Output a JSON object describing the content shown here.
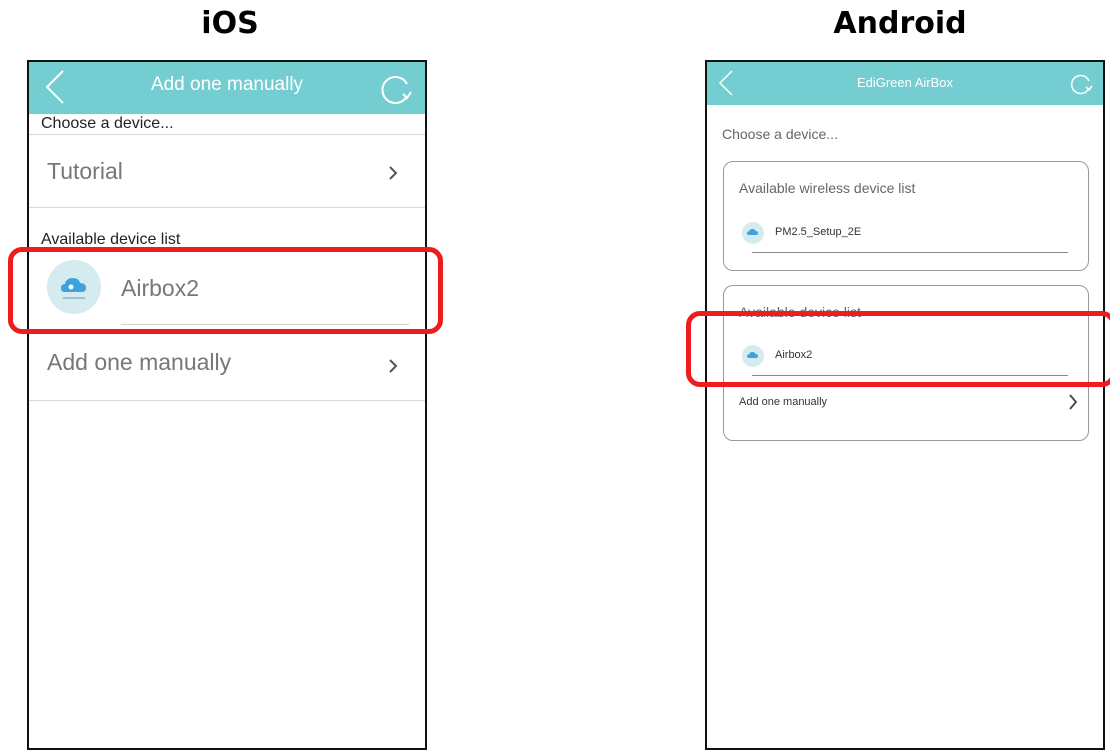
{
  "headings": {
    "ios": "iOS",
    "android": "Android"
  },
  "ios": {
    "title": "Add one manually",
    "choose_label": "Choose a device...",
    "tutorial_label": "Tutorial",
    "available_list_label": "Available device list",
    "device_name": "Airbox2",
    "add_manually_label": "Add one manually"
  },
  "android": {
    "title": "EdiGreen AirBox",
    "choose_label": "Choose a device...",
    "wireless_list_label": "Available wireless device list",
    "wireless_device_name": "PM2.5_Setup_2E",
    "available_list_label": "Available device list",
    "device_name": "Airbox2",
    "add_manually_label": "Add one manually"
  },
  "colors": {
    "topbar": "#74cdd1",
    "highlight": "#ee1c1c"
  },
  "icons": [
    "back-arrow-icon",
    "refresh-icon",
    "chevron-right-icon",
    "cloud-device-icon"
  ]
}
